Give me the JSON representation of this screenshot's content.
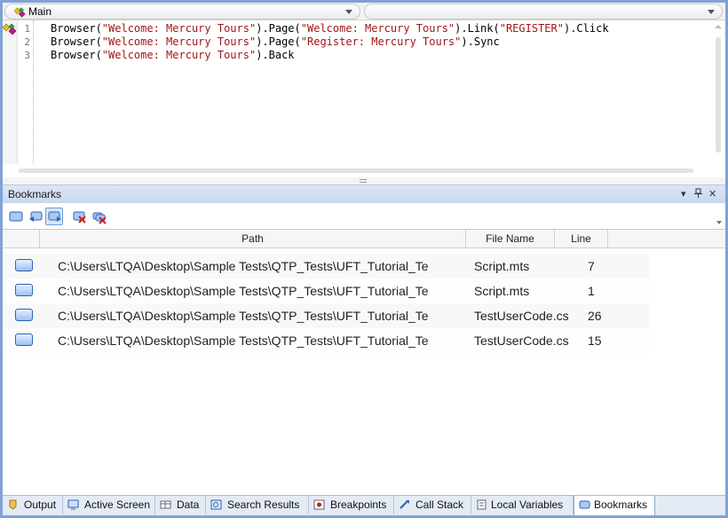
{
  "topbar": {
    "left_combo_value": "Main",
    "right_combo_value": ""
  },
  "editor": {
    "line_numbers": [
      "1",
      "2",
      "3"
    ],
    "lines": [
      [
        {
          "t": "Browser(",
          "s": false
        },
        {
          "t": "\"Welcome: Mercury Tours\"",
          "s": true
        },
        {
          "t": ").Page(",
          "s": false
        },
        {
          "t": "\"Welcome: Mercury Tours\"",
          "s": true
        },
        {
          "t": ").Link(",
          "s": false
        },
        {
          "t": "\"REGISTER\"",
          "s": true
        },
        {
          "t": ").Click",
          "s": false
        }
      ],
      [
        {
          "t": "Browser(",
          "s": false
        },
        {
          "t": "\"Welcome: Mercury Tours\"",
          "s": true
        },
        {
          "t": ").Page(",
          "s": false
        },
        {
          "t": "\"Register: Mercury Tours\"",
          "s": true
        },
        {
          "t": ").Sync",
          "s": false
        }
      ],
      [
        {
          "t": "Browser(",
          "s": false
        },
        {
          "t": "\"Welcome: Mercury Tours\"",
          "s": true
        },
        {
          "t": ").Back",
          "s": false
        }
      ]
    ]
  },
  "bookmarks_pane": {
    "title": "Bookmarks",
    "pin_glyph": "▾ ⊥",
    "close_glyph": "✕",
    "columns": {
      "path": "Path",
      "file_name": "File Name",
      "line": "Line"
    },
    "rows": [
      {
        "path": "C:\\Users\\LTQA\\Desktop\\Sample Tests\\QTP_Tests\\UFT_Tutorial_Te",
        "file_name": "Script.mts",
        "line": "7"
      },
      {
        "path": "C:\\Users\\LTQA\\Desktop\\Sample Tests\\QTP_Tests\\UFT_Tutorial_Te",
        "file_name": "Script.mts",
        "line": "1"
      },
      {
        "path": "C:\\Users\\LTQA\\Desktop\\Sample Tests\\QTP_Tests\\UFT_Tutorial_Te",
        "file_name": "TestUserCode.cs",
        "line": "26"
      },
      {
        "path": "C:\\Users\\LTQA\\Desktop\\Sample Tests\\QTP_Tests\\UFT_Tutorial_Te",
        "file_name": "TestUserCode.cs",
        "line": "15"
      }
    ]
  },
  "tabs": [
    {
      "label": "Output",
      "icon": "output-icon"
    },
    {
      "label": "Active Screen",
      "icon": "active-screen-icon"
    },
    {
      "label": "Data",
      "icon": "data-icon"
    },
    {
      "label": "Search Results",
      "icon": "search-results-icon"
    },
    {
      "label": "Breakpoints",
      "icon": "breakpoints-icon"
    },
    {
      "label": "Call Stack",
      "icon": "call-stack-icon"
    },
    {
      "label": "Local Variables",
      "icon": "local-variables-icon"
    },
    {
      "label": "Bookmarks",
      "icon": "bookmarks-icon",
      "selected": true
    }
  ],
  "colors": {
    "string_literal": "#a31515",
    "frame_border": "#7fa3d4",
    "pane_header": "#c8d8ee",
    "bookmark_icon": "#2d62b8"
  }
}
